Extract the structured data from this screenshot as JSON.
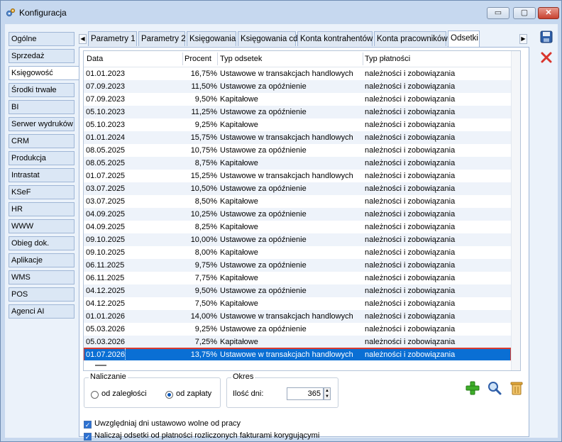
{
  "window": {
    "title": "Konfiguracja",
    "controls": {
      "minimize": "▭",
      "maximize": "▢",
      "close": "✕"
    }
  },
  "nav": {
    "items": [
      "Ogólne",
      "Sprzedaż",
      "Księgowość",
      "Środki trwałe",
      "BI",
      "Serwer wydruków",
      "CRM",
      "Produkcja",
      "Intrastat",
      "KSeF",
      "HR",
      "WWW",
      "Obieg dok.",
      "Aplikacje",
      "WMS",
      "POS",
      "Agenci AI"
    ],
    "active_index": 2
  },
  "tabs": {
    "items": [
      "Parametry 1",
      "Parametry 2",
      "Księgowania",
      "Księgowania cd",
      "Konta kontrahentów",
      "Konta pracowników",
      "Odsetki"
    ],
    "active_index": 6,
    "left_arrow": "◀",
    "right_arrow": "▶"
  },
  "grid": {
    "columns": [
      "Data",
      "Procent",
      "Typ odsetek",
      "Typ płatności"
    ],
    "rows": [
      [
        "01.01.2023",
        "16,75%",
        "Ustawowe w transakcjach handlowych",
        "należności i zobowiązania"
      ],
      [
        "07.09.2023",
        "11,50%",
        "Ustawowe za opóźnienie",
        "należności i zobowiązania"
      ],
      [
        "07.09.2023",
        "9,50%",
        "Kapitałowe",
        "należności i zobowiązania"
      ],
      [
        "05.10.2023",
        "11,25%",
        "Ustawowe za opóźnienie",
        "należności i zobowiązania"
      ],
      [
        "05.10.2023",
        "9,25%",
        "Kapitałowe",
        "należności i zobowiązania"
      ],
      [
        "01.01.2024",
        "15,75%",
        "Ustawowe w transakcjach handlowych",
        "należności i zobowiązania"
      ],
      [
        "08.05.2025",
        "10,75%",
        "Ustawowe za opóźnienie",
        "należności i zobowiązania"
      ],
      [
        "08.05.2025",
        "8,75%",
        "Kapitałowe",
        "należności i zobowiązania"
      ],
      [
        "01.07.2025",
        "15,25%",
        "Ustawowe w transakcjach handlowych",
        "należności i zobowiązania"
      ],
      [
        "03.07.2025",
        "10,50%",
        "Ustawowe za opóźnienie",
        "należności i zobowiązania"
      ],
      [
        "03.07.2025",
        "8,50%",
        "Kapitałowe",
        "należności i zobowiązania"
      ],
      [
        "04.09.2025",
        "10,25%",
        "Ustawowe za opóźnienie",
        "należności i zobowiązania"
      ],
      [
        "04.09.2025",
        "8,25%",
        "Kapitałowe",
        "należności i zobowiązania"
      ],
      [
        "09.10.2025",
        "10,00%",
        "Ustawowe za opóźnienie",
        "należności i zobowiązania"
      ],
      [
        "09.10.2025",
        "8,00%",
        "Kapitałowe",
        "należności i zobowiązania"
      ],
      [
        "06.11.2025",
        "9,75%",
        "Ustawowe za opóźnienie",
        "należności i zobowiązania"
      ],
      [
        "06.11.2025",
        "7,75%",
        "Kapitałowe",
        "należności i zobowiązania"
      ],
      [
        "04.12.2025",
        "9,50%",
        "Ustawowe za opóźnienie",
        "należności i zobowiązania"
      ],
      [
        "04.12.2025",
        "7,50%",
        "Kapitałowe",
        "należności i zobowiązania"
      ],
      [
        "01.01.2026",
        "14,00%",
        "Ustawowe w transakcjach handlowych",
        "należności i zobowiązania"
      ],
      [
        "05.03.2026",
        "9,25%",
        "Ustawowe za opóźnienie",
        "należności i zobowiązania"
      ],
      [
        "05.03.2026",
        "7,25%",
        "Kapitałowe",
        "należności i zobowiązania"
      ],
      [
        "01.07.2026",
        "13,75%",
        "Ustawowe w transakcjach handlowych",
        "należności i zobowiązania"
      ]
    ],
    "selected_index": 22
  },
  "naliczanie": {
    "label": "Naliczanie",
    "option_1": "od zaległości",
    "option_2": "od zapłaty",
    "selected": "od zapłaty"
  },
  "okres": {
    "label": "Okres",
    "days_label": "Ilość dni:",
    "days_value": "365"
  },
  "checkboxes": {
    "korygujace": "Naliczaj odsetki od płatności rozliczonych fakturami korygującymi",
    "dni_wolne": "Uwzględniaj dni ustawowo wolne od pracy"
  },
  "colors": {
    "selection": "#0a6fd4",
    "selection_outline": "#d83a2f",
    "add": "#3fae2a",
    "delete": "#d9342b",
    "save": "#2e5ea8"
  }
}
